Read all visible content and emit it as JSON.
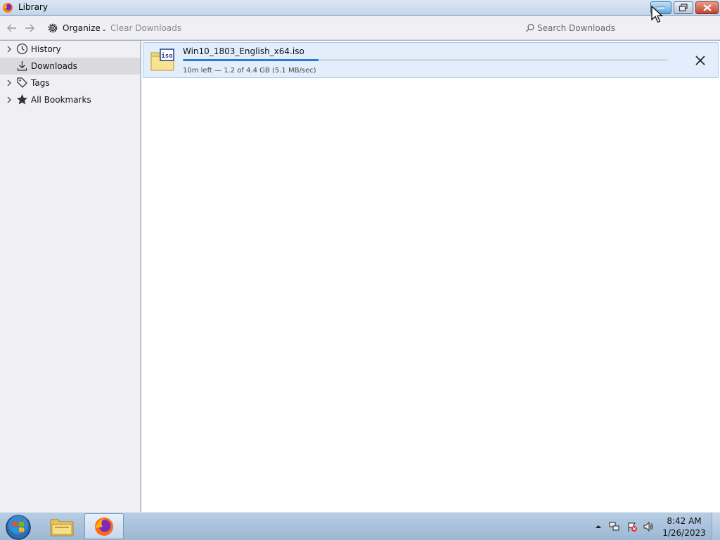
{
  "window": {
    "title": "Library"
  },
  "toolbar": {
    "organize_label": "Organize",
    "organize_caret": "⌄",
    "clear_downloads_label": "Clear Downloads",
    "search_placeholder": "Search Downloads"
  },
  "sidebar": {
    "items": [
      {
        "label": "History",
        "icon": "clock-icon",
        "expandable": true,
        "selected": false
      },
      {
        "label": "Downloads",
        "icon": "download-icon",
        "expandable": false,
        "selected": true
      },
      {
        "label": "Tags",
        "icon": "tag-icon",
        "expandable": true,
        "selected": false
      },
      {
        "label": "All Bookmarks",
        "icon": "star-icon",
        "expandable": true,
        "selected": false
      }
    ]
  },
  "downloads": [
    {
      "filename": "Win10_1803_English_x64.iso",
      "file_icon_label": "iso",
      "status": "10m left — 1.2 of 4.4 GB (5.1 MB/sec)",
      "progress": 0.28
    }
  ],
  "taskbar": {
    "time": "8:42 AM",
    "date": "1/26/2023"
  },
  "colors": {
    "accent": "#2a7bd6",
    "selected_row": "#e2eefb",
    "sidebar_selected": "#d9d9de"
  }
}
